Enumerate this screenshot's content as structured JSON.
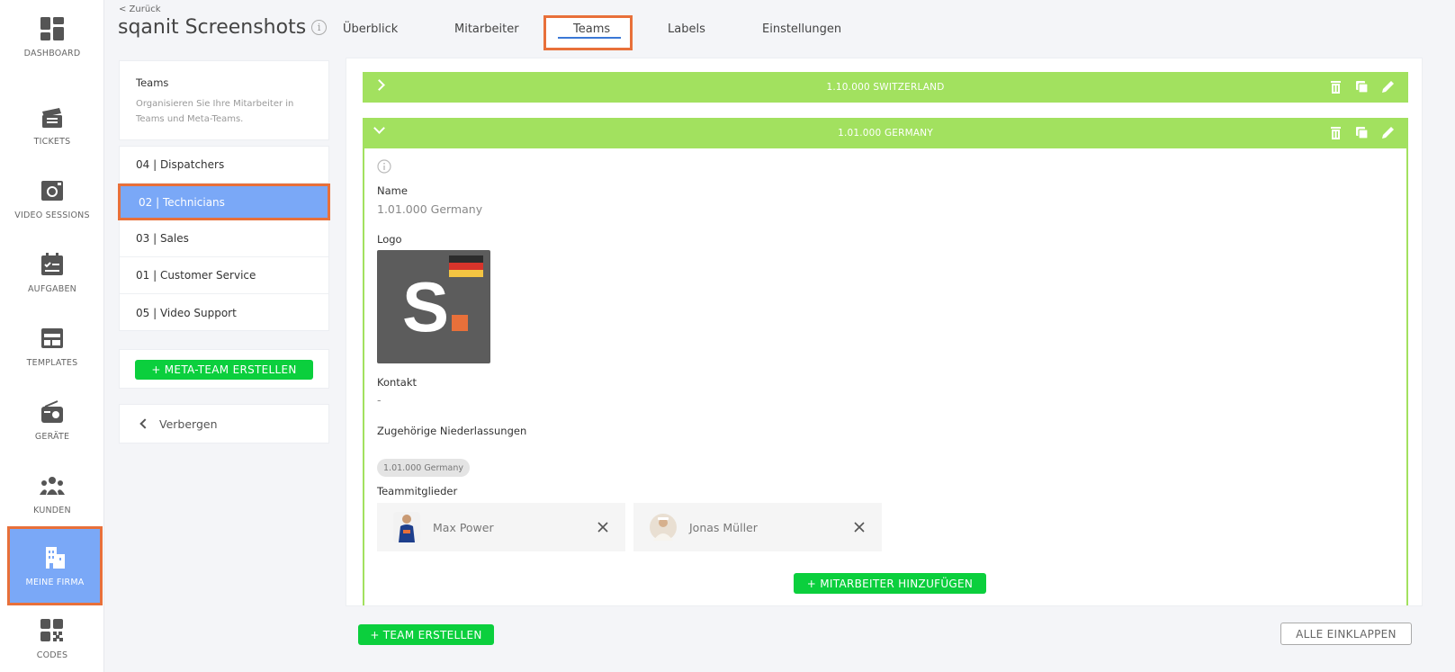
{
  "nav": {
    "items": [
      {
        "label": "DASHBOARD",
        "icon": "dashboard-icon"
      },
      {
        "label": "TICKETS",
        "icon": "tickets-icon"
      },
      {
        "label": "VIDEO SESSIONS",
        "icon": "video-sessions-icon"
      },
      {
        "label": "AUFGABEN",
        "icon": "tasks-icon"
      },
      {
        "label": "TEMPLATES",
        "icon": "templates-icon"
      },
      {
        "label": "GERÄTE",
        "icon": "devices-icon"
      },
      {
        "label": "KUNDEN",
        "icon": "customers-icon"
      },
      {
        "label": "MEINE FIRMA",
        "icon": "company-icon"
      },
      {
        "label": "CODES",
        "icon": "codes-icon"
      }
    ],
    "active": "MEINE FIRMA"
  },
  "header": {
    "back": "< Zurück",
    "title": "sqanit Screenshots",
    "info_icon": "i",
    "tabs": [
      "Überblick",
      "Mitarbeiter",
      "Teams",
      "Labels",
      "Einstellungen"
    ],
    "active_tab": "Teams"
  },
  "teams_panel": {
    "heading": "Teams",
    "description": "Organisieren Sie Ihre Mitarbeiter in Teams und Meta-Teams.",
    "teams": [
      "04 | Dispatchers",
      "02 | Technicians",
      "03 | Sales",
      "01 | Customer Service",
      "05 | Video Support"
    ],
    "selected": "02 | Technicians",
    "meta_button": "+ META-TEAM ERSTELLEN",
    "hide_label": "Verbergen"
  },
  "main": {
    "collapsed_bar": "1.10.000 SWITZERLAND",
    "expanded_bar": "1.01.000 GERMANY",
    "detail": {
      "name_label": "Name",
      "name_value": "1.01.000 Germany",
      "logo_label": "Logo",
      "logo_letter": "S",
      "contact_label": "Kontakt",
      "contact_value": "-",
      "branches_label": "Zugehörige Niederlassungen",
      "branch_chip": "1.01.000 Germany",
      "members_label": "Teammitglieder",
      "members": [
        "Max Power",
        "Jonas Müller"
      ],
      "add_member_button": "+ MITARBEITER HINZUFÜGEN"
    },
    "create_team_button": "+ TEAM ERSTELLEN",
    "collapse_all_button": "ALLE EINKLAPPEN"
  },
  "colors": {
    "accent_green": "#0bcf3d",
    "bar_green": "#a2e15f",
    "selection_blue": "#7aa8f7",
    "highlight_orange": "#e8703a",
    "logo_dark": "#5c5c5c"
  }
}
